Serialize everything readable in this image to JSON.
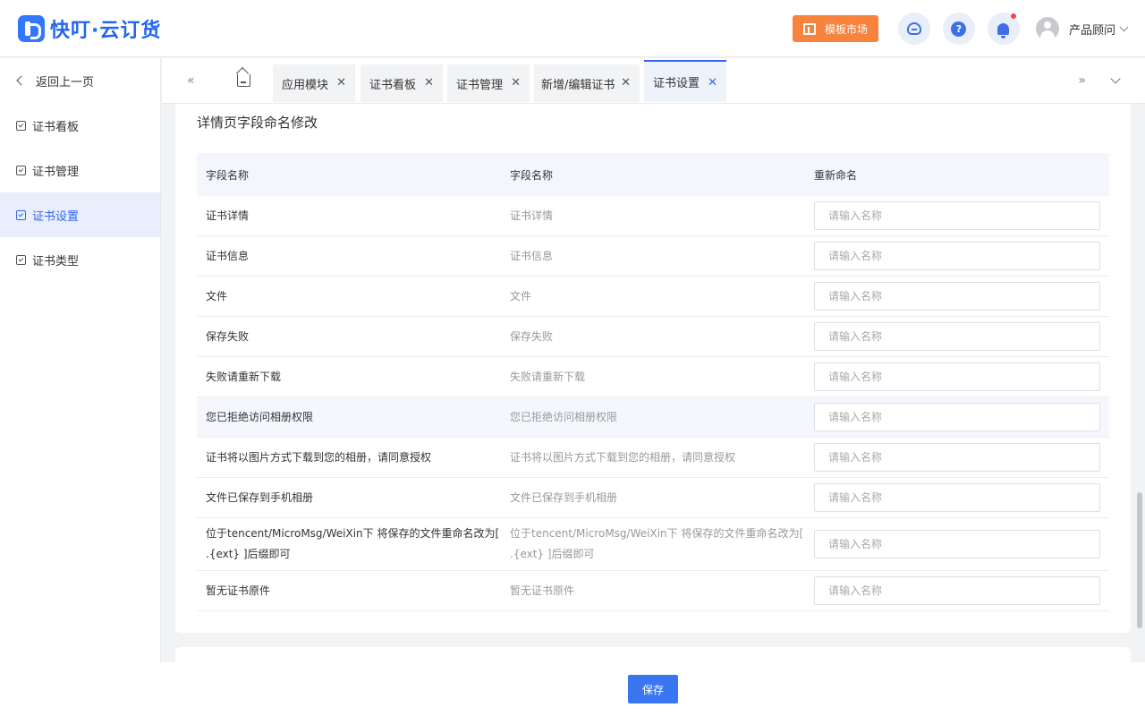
{
  "app": {
    "name": "快叮·云订货"
  },
  "header": {
    "market_label": "模板市场",
    "user_name": "产品顾问"
  },
  "sidebar": {
    "back_label": "返回上一页",
    "items": [
      {
        "label": "证书看板"
      },
      {
        "label": "证书管理"
      },
      {
        "label": "证书设置",
        "active": true
      },
      {
        "label": "证书类型"
      }
    ]
  },
  "tabs": [
    {
      "label": "应用模块"
    },
    {
      "label": "证书看板"
    },
    {
      "label": "证书管理"
    },
    {
      "label": "新增/编辑证书"
    },
    {
      "label": "证书设置",
      "active": true
    }
  ],
  "section": {
    "title": "详情页字段命名修改",
    "columns": [
      "字段名称",
      "字段名称",
      "重新命名"
    ],
    "placeholder": "请输入名称",
    "rows": [
      {
        "field": "证书详情",
        "original": "证书详情"
      },
      {
        "field": "证书信息",
        "original": "证书信息"
      },
      {
        "field": "文件",
        "original": "文件"
      },
      {
        "field": "保存失败",
        "original": "保存失败"
      },
      {
        "field": "失败请重新下载",
        "original": "失败请重新下载"
      },
      {
        "field": "您已拒绝访问相册权限",
        "original": "您已拒绝访问相册权限"
      },
      {
        "field": "证书将以图片方式下载到您的相册，请同意授权",
        "original": "证书将以图片方式下载到您的相册，请同意授权"
      },
      {
        "field": "文件已保存到手机相册",
        "original": "文件已保存到手机相册"
      },
      {
        "field": "位于tencent/MicroMsg/WeiXin下 将保存的文件重命名改为[ .{ext} ]后缀即可",
        "original": "位于tencent/MicroMsg/WeiXin下 将保存的文件重命名改为[ .{ext} ]后缀即可"
      },
      {
        "field": "暂无证书原件",
        "original": "暂无证书原件"
      }
    ]
  },
  "footer": {
    "save_label": "保存"
  },
  "colors": {
    "accent": "#3a76f0",
    "market": "#f7833d",
    "active_bg": "#e9eefc"
  }
}
